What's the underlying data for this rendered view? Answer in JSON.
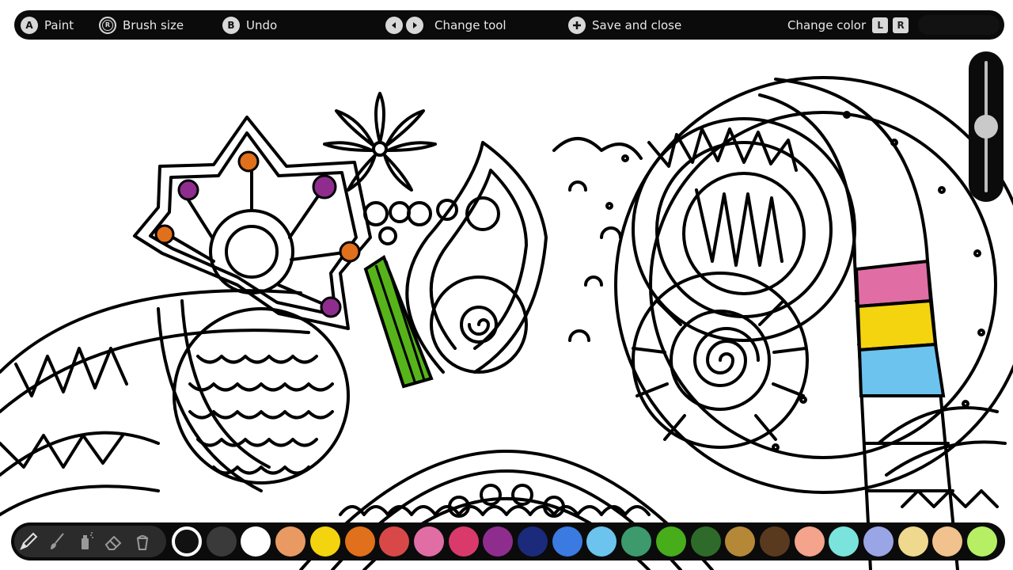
{
  "hints": {
    "paint": {
      "button": "A",
      "label": "Paint"
    },
    "brush_size": {
      "button": "R",
      "label": "Brush size"
    },
    "undo": {
      "button": "B",
      "label": "Undo"
    },
    "change_tool": {
      "label": "Change tool"
    },
    "save_close": {
      "label": "Save and close"
    },
    "change_color": {
      "label": "Change color",
      "key_left": "L",
      "key_right": "R"
    }
  },
  "brush_size_level": 0.5,
  "tools": [
    {
      "name": "pencil-icon",
      "selected": true
    },
    {
      "name": "brush-icon",
      "selected": false
    },
    {
      "name": "spray-icon",
      "selected": false
    },
    {
      "name": "eraser-icon",
      "selected": false
    },
    {
      "name": "bucket-icon",
      "selected": false
    }
  ],
  "palette": {
    "selected_index": 0,
    "colors": [
      "#111111",
      "#3a3a3a",
      "#ffffff",
      "#e99a63",
      "#f3d40f",
      "#e0701b",
      "#d94848",
      "#e06ea4",
      "#d93a6b",
      "#8f2d8f",
      "#1b2a7a",
      "#3b7ae0",
      "#6cc3ee",
      "#3d9a6c",
      "#47ad1b",
      "#2e6b2a",
      "#b58838",
      "#5a3a1e",
      "#f4a38c",
      "#7ae4dc",
      "#9aa5e6",
      "#eed98e",
      "#f1c28d",
      "#b6ef63"
    ]
  },
  "fills": {
    "green": "#56b41a",
    "pink": "#e06ea4",
    "yellow": "#f3d40f",
    "blue": "#6cc3ee",
    "purple": "#8f2d8f",
    "orange": "#e0701b"
  }
}
